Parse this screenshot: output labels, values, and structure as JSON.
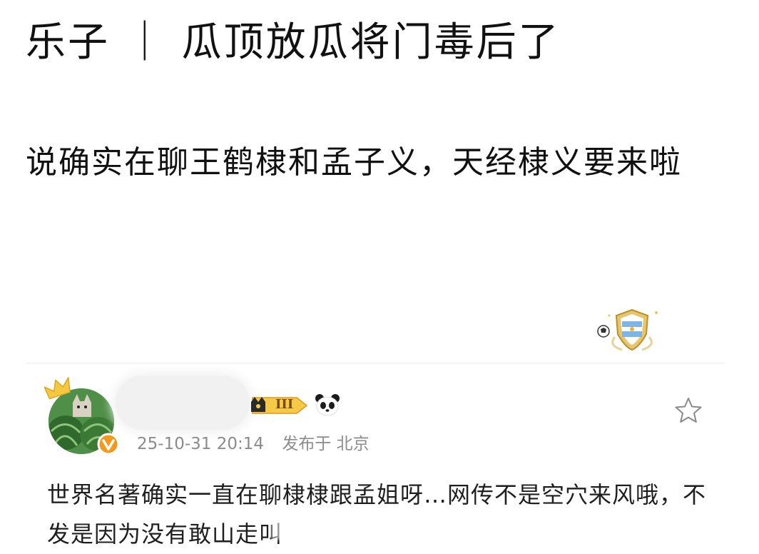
{
  "post": {
    "title": "乐子 ｜ 瓜顶放瓜将门毒后了",
    "body": "说确实在聊王鹤棣和孟子义，天经棣义要来啦"
  },
  "comment": {
    "timestamp": "25-10-31 20:14",
    "location": "发布于 北京",
    "level_badge": "III",
    "text": "世界名著确实一直在聊棣棣跟孟姐呀…网传不是空穴来风哦，不发是因为没有敢山走叫"
  },
  "icons": {
    "favorite": "star-outline-icon",
    "member": "crown-level-badge-icon",
    "emoji": "panda-icon",
    "verified": "verified-v-icon"
  },
  "colors": {
    "accent_orange": "#f5a623",
    "verified_orange": "#f39a1e",
    "meta_gray": "#8c8c8c"
  }
}
